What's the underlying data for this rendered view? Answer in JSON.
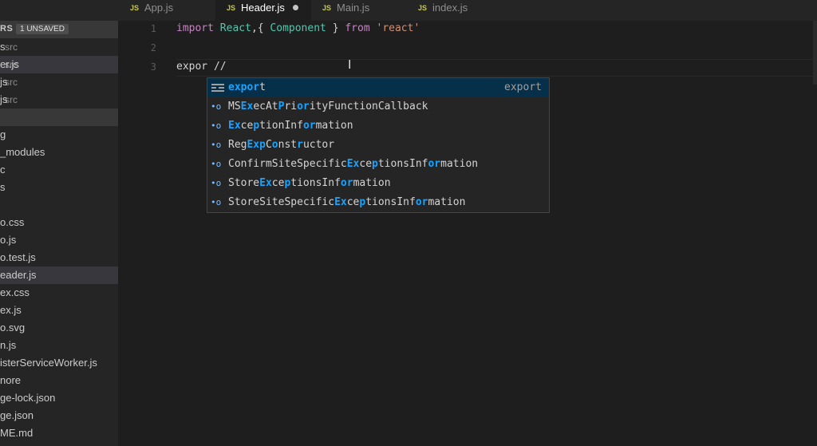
{
  "tabs": [
    {
      "label": "App.js",
      "badge": "JS",
      "active": false,
      "dirty": false
    },
    {
      "label": "Header.js",
      "badge": "JS",
      "active": true,
      "dirty": true
    },
    {
      "label": "Main.js",
      "badge": "JS",
      "active": false,
      "dirty": false
    },
    {
      "label": "index.js",
      "badge": "JS",
      "active": false,
      "dirty": false
    }
  ],
  "sidebar": {
    "open_editors_title": "RS",
    "unsaved_badge": "1 UNSAVED",
    "open_editors": [
      {
        "name": "s",
        "folder": "src"
      },
      {
        "name": "er.js",
        "folder": "src"
      },
      {
        "name": "js",
        "folder": "src"
      },
      {
        "name": "js",
        "folder": "src"
      }
    ],
    "files": [
      "g",
      "_modules",
      "c",
      "s",
      "",
      "o.css",
      "o.js",
      "o.test.js",
      "eader.js",
      "ex.css",
      "ex.js",
      "o.svg",
      "n.js",
      "isterServiceWorker.js",
      "nore",
      "ge-lock.json",
      "ge.json",
      "ME.md"
    ]
  },
  "editor": {
    "line_numbers": [
      "1",
      "2",
      "3"
    ],
    "line1": {
      "kw1": "import",
      "cls1": "React",
      "p1": ",{ ",
      "cls2": "Component",
      "p2": " } ",
      "kw2": "from",
      "sp": " ",
      "str": "'react'"
    },
    "line3": "expor //"
  },
  "suggest": {
    "selected_detail": "export",
    "items": [
      {
        "icon": "keyword-icon",
        "parts": [
          {
            "t": "expor",
            "h": true
          },
          {
            "t": "t",
            "h": false
          }
        ]
      },
      {
        "icon": "method-icon",
        "parts": [
          {
            "t": "MS",
            "h": false
          },
          {
            "t": "Ex",
            "h": true
          },
          {
            "t": "ecAt",
            "h": false
          },
          {
            "t": "P",
            "h": true
          },
          {
            "t": "ri",
            "h": false
          },
          {
            "t": "or",
            "h": true
          },
          {
            "t": "ityFunctionCallback",
            "h": false
          }
        ]
      },
      {
        "icon": "method-icon",
        "parts": [
          {
            "t": "Ex",
            "h": true
          },
          {
            "t": "ce",
            "h": false
          },
          {
            "t": "p",
            "h": true
          },
          {
            "t": "tionInf",
            "h": false
          },
          {
            "t": "or",
            "h": true
          },
          {
            "t": "mation",
            "h": false
          }
        ]
      },
      {
        "icon": "method-icon",
        "parts": [
          {
            "t": "Reg",
            "h": false
          },
          {
            "t": "Exp",
            "h": true
          },
          {
            "t": "C",
            "h": false
          },
          {
            "t": "o",
            "h": true
          },
          {
            "t": "nst",
            "h": false
          },
          {
            "t": "r",
            "h": true
          },
          {
            "t": "uctor",
            "h": false
          }
        ]
      },
      {
        "icon": "method-icon",
        "parts": [
          {
            "t": "ConfirmSiteSpecific",
            "h": false
          },
          {
            "t": "Ex",
            "h": true
          },
          {
            "t": "ce",
            "h": false
          },
          {
            "t": "p",
            "h": true
          },
          {
            "t": "tionsInf",
            "h": false
          },
          {
            "t": "or",
            "h": true
          },
          {
            "t": "mation",
            "h": false
          }
        ]
      },
      {
        "icon": "method-icon",
        "parts": [
          {
            "t": "Store",
            "h": false
          },
          {
            "t": "Ex",
            "h": true
          },
          {
            "t": "ce",
            "h": false
          },
          {
            "t": "p",
            "h": true
          },
          {
            "t": "tionsInf",
            "h": false
          },
          {
            "t": "or",
            "h": true
          },
          {
            "t": "mation",
            "h": false
          }
        ]
      },
      {
        "icon": "method-icon",
        "parts": [
          {
            "t": "StoreSiteSpecific",
            "h": false
          },
          {
            "t": "Ex",
            "h": true
          },
          {
            "t": "ce",
            "h": false
          },
          {
            "t": "p",
            "h": true
          },
          {
            "t": "tionsInf",
            "h": false
          },
          {
            "t": "or",
            "h": true
          },
          {
            "t": "mation",
            "h": false
          }
        ]
      }
    ]
  },
  "colors": {
    "accent": "#18a3ff",
    "selection": "#062f4a",
    "js_badge": "#cbcb41"
  }
}
